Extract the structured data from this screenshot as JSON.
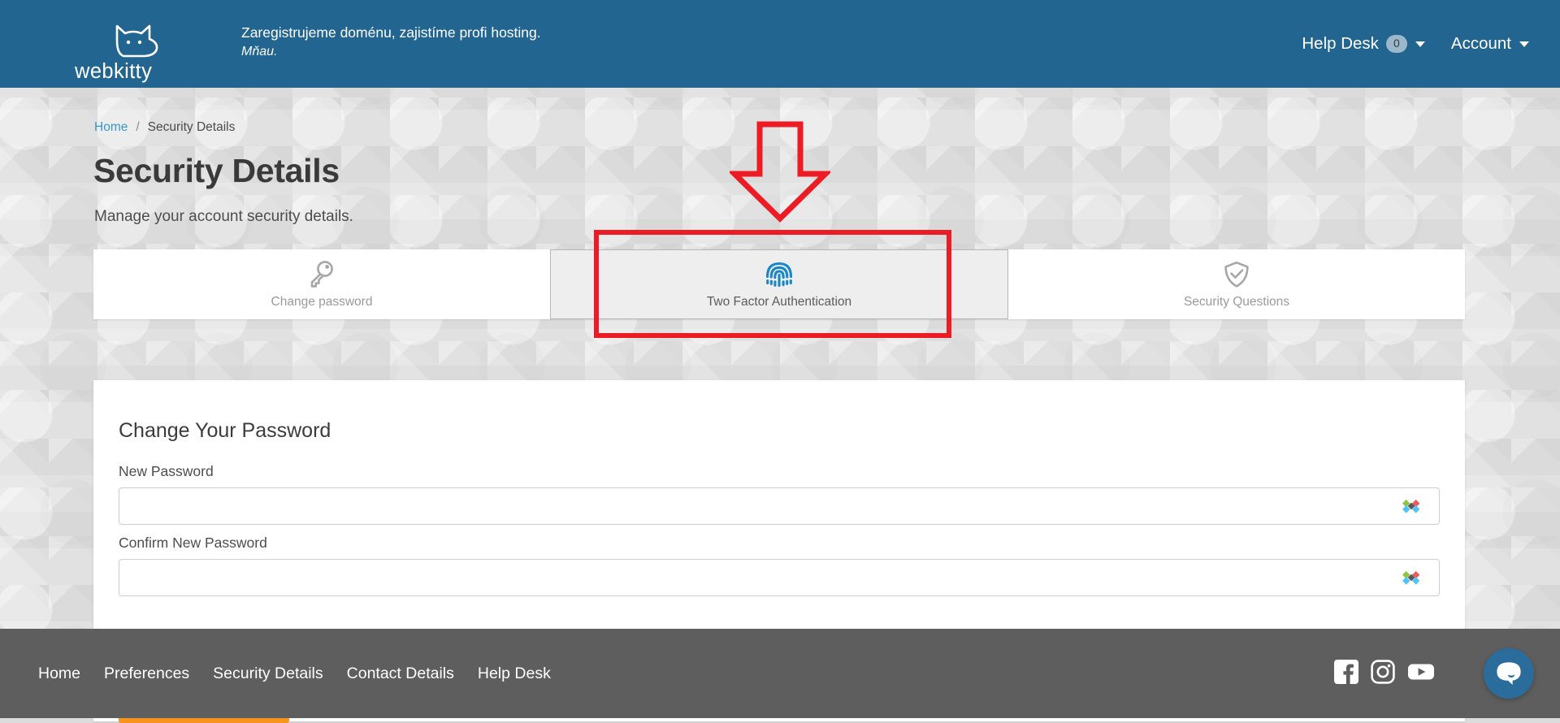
{
  "header": {
    "logo_text": "webkitty",
    "logo_icon": "cat-face-icon",
    "tagline_line1": "Zaregistrujeme doménu, zajistíme profi hosting.",
    "tagline_line2": "Mňau.",
    "nav": [
      {
        "label": "Help Desk",
        "badge": "0",
        "has_caret": true
      },
      {
        "label": "Account",
        "badge": null,
        "has_caret": true
      }
    ],
    "bg_color": "#226591"
  },
  "breadcrumb": {
    "home": "Home",
    "separator": "/",
    "current": "Security Details",
    "link_color": "#3a97c9"
  },
  "page": {
    "title": "Security Details",
    "subtitle": "Manage your account security details."
  },
  "tabs": [
    {
      "label": "Change password",
      "icon": "key-icon",
      "state": "normal"
    },
    {
      "label": "Two Factor Authentication",
      "icon": "fingerprint-icon",
      "state": "hovered",
      "icon_color": "#1a87c4"
    },
    {
      "label": "Security Questions",
      "icon": "shield-check-icon",
      "state": "normal"
    }
  ],
  "card": {
    "title": "Change Your Password",
    "fields": [
      {
        "label": "New Password",
        "value": "",
        "placeholder": "",
        "trailing_icon": "password-manager-icon"
      },
      {
        "label": "Confirm New Password",
        "value": "",
        "placeholder": "",
        "trailing_icon": "password-manager-icon"
      }
    ],
    "submit_label": "",
    "submit_color": "#f7941e"
  },
  "annotations": {
    "arrow": {
      "type": "down-arrow",
      "color": "#ed1c24"
    },
    "box": {
      "type": "rectangle-highlight",
      "color": "#ed1c24",
      "targets_tab": "Two Factor Authentication"
    }
  },
  "footer": {
    "links": [
      "Home",
      "Preferences",
      "Security Details",
      "Contact Details",
      "Help Desk"
    ],
    "social": [
      "facebook-icon",
      "instagram-icon",
      "youtube-icon"
    ],
    "chat_icon": "chat-bubble-icon",
    "bg_color": "#5e5e5e",
    "chat_color": "#2a6d9c"
  }
}
